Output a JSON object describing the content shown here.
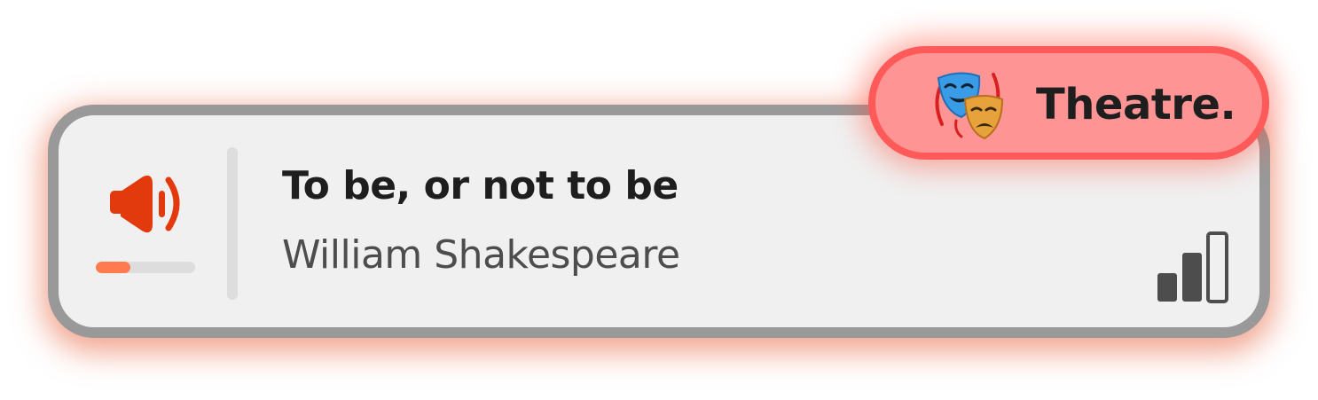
{
  "track": {
    "title": "To be, or not to be",
    "artist": "William Shakespeare"
  },
  "volume": {
    "level": 0.35,
    "icon": "speaker-volume-icon",
    "accent_color": "#e23a0c",
    "fill_color": "#ff7a4f"
  },
  "signal": {
    "icon": "signal-strength-icon",
    "bars_filled": 2,
    "bars_total": 3
  },
  "badge": {
    "label": "Theatre.",
    "icon": "performing-arts-masks-icon",
    "background_color": "#ff9494",
    "border_color": "#ff5a5a"
  },
  "card": {
    "background_color": "#f0f0f0",
    "border_color": "#999999"
  }
}
